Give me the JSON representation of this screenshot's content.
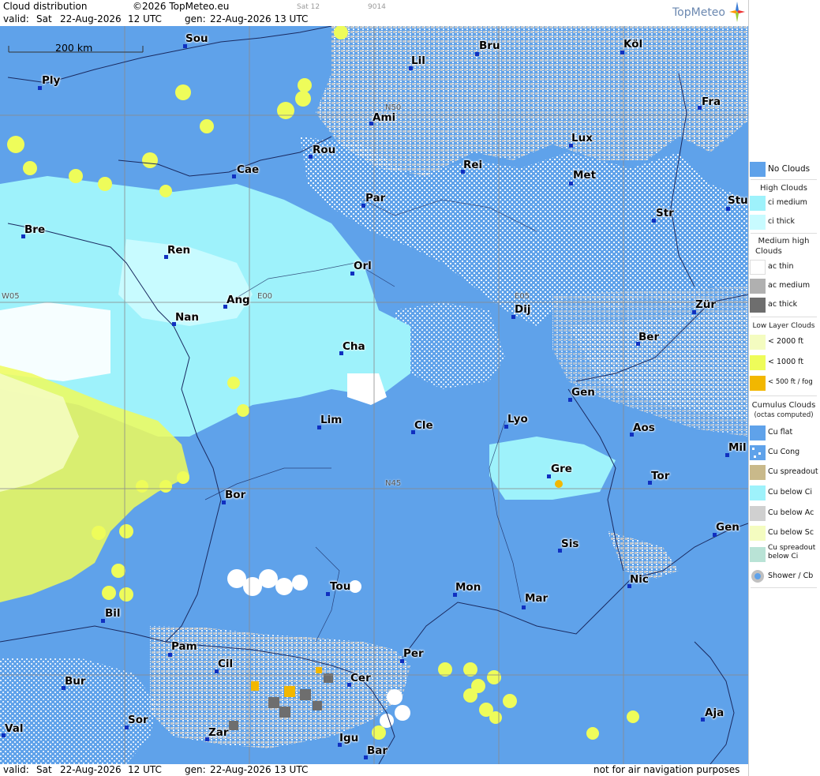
{
  "header": {
    "title": "Cloud distribution",
    "copyright": "©2026 TopMeteo.eu",
    "sat": "Sat 12",
    "code": "9014",
    "valid_label": "valid:",
    "valid_day": "Sat",
    "valid_date": "22-Aug-2026",
    "valid_time": "12 UTC",
    "gen_label": "gen:",
    "gen_value": "22-Aug-2026 13 UTC",
    "logo": "TopMeteo"
  },
  "footer": {
    "valid_label": "valid:",
    "valid_day": "Sat",
    "valid_date": "22-Aug-2026",
    "valid_time": "12 UTC",
    "gen_label": "gen:",
    "gen_value": "22-Aug-2026 13 UTC",
    "disclaimer": "not for air navigation purposes"
  },
  "scale": {
    "label": "200 km"
  },
  "grid_labels": {
    "n50": "N50",
    "n45": "N45",
    "w05": "W05",
    "e00": "E00",
    "e05": "E05"
  },
  "cities": [
    {
      "name": "Sou"
    },
    {
      "name": "Ply"
    },
    {
      "name": "Lil"
    },
    {
      "name": "Bru"
    },
    {
      "name": "Köl"
    },
    {
      "name": "Ami"
    },
    {
      "name": "Fra"
    },
    {
      "name": "Rou"
    },
    {
      "name": "Lux"
    },
    {
      "name": "Cae"
    },
    {
      "name": "Rei"
    },
    {
      "name": "Met"
    },
    {
      "name": "Par"
    },
    {
      "name": "Stu"
    },
    {
      "name": "Bre"
    },
    {
      "name": "Str"
    },
    {
      "name": "Ren"
    },
    {
      "name": "Orl"
    },
    {
      "name": "Ang"
    },
    {
      "name": "Dij"
    },
    {
      "name": "Zür"
    },
    {
      "name": "Nan"
    },
    {
      "name": "Cha"
    },
    {
      "name": "Ber"
    },
    {
      "name": "Gen"
    },
    {
      "name": "Lim"
    },
    {
      "name": "Cle"
    },
    {
      "name": "Lyo"
    },
    {
      "name": "Aos"
    },
    {
      "name": "Mil"
    },
    {
      "name": "Gre"
    },
    {
      "name": "Tor"
    },
    {
      "name": "Bor"
    },
    {
      "name": "Sis"
    },
    {
      "name": "Gen"
    },
    {
      "name": "Tou"
    },
    {
      "name": "Mon"
    },
    {
      "name": "Nic"
    },
    {
      "name": "Mar"
    },
    {
      "name": "Bil"
    },
    {
      "name": "Pam"
    },
    {
      "name": "Per"
    },
    {
      "name": "Cil"
    },
    {
      "name": "Cer"
    },
    {
      "name": "Bur"
    },
    {
      "name": "Sor"
    },
    {
      "name": "Aja"
    },
    {
      "name": "Val"
    },
    {
      "name": "Zar"
    },
    {
      "name": "Igu"
    },
    {
      "name": "Bar"
    }
  ],
  "legend": {
    "no_clouds": "No Clouds",
    "high_title": "High Clouds",
    "ci_medium": "ci medium",
    "ci_thick": "ci thick",
    "medium_title_1": "Medium high",
    "medium_title_2": "Clouds",
    "ac_thin": "ac thin",
    "ac_medium": "ac medium",
    "ac_thick": "ac thick",
    "low_title": "Low Layer Clouds",
    "low_2000": "< 2000 ft",
    "low_1000": "< 1000 ft",
    "low_500": "< 500 ft / fog",
    "cu_title_1": "Cumulus Clouds",
    "cu_title_2": "(octas computed)",
    "cu_flat": "Cu flat",
    "cu_cong": "Cu Cong",
    "cu_spreadout": "Cu spreadout",
    "cu_below_ci": "Cu below Ci",
    "cu_below_ac": "Cu below Ac",
    "cu_below_sc": "Cu below Sc",
    "cu_spreadout_below_ci_1": "Cu spreadout",
    "cu_spreadout_below_ci_2": "below Ci",
    "shower_cb": "Shower / Cb"
  },
  "colors": {
    "no_clouds": "#5fa2ea",
    "ci_medium": "#9ef2fb",
    "ci_thick": "#c8fbff",
    "ac_thin": "#ffffff",
    "ac_medium": "#b0b0b0",
    "ac_thick": "#6e6e6e",
    "low_2000": "#f4fcc0",
    "low_1000": "#eefc5a",
    "low_500": "#f2b700"
  }
}
